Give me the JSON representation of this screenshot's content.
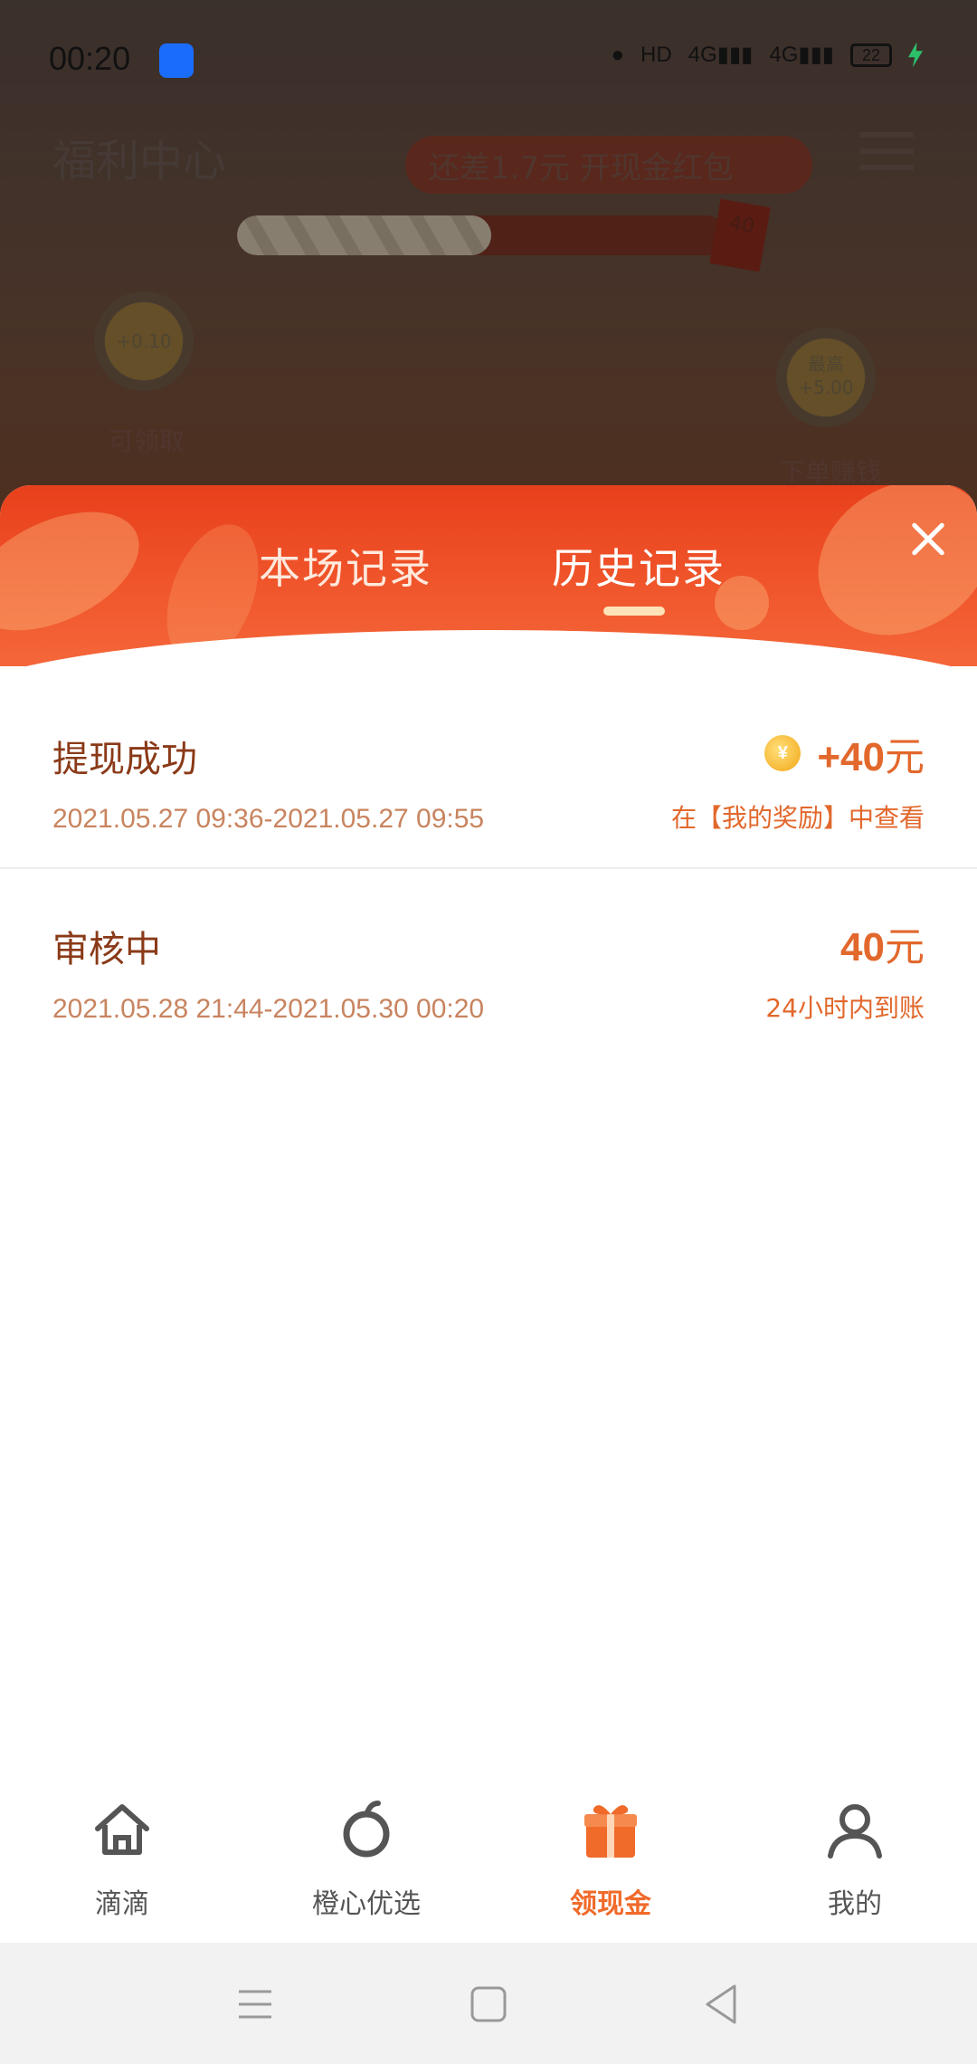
{
  "status_bar": {
    "time": "00:20",
    "battery": "22"
  },
  "background": {
    "title": "福利中心",
    "pill_text": "还差1.7元 开现金红包",
    "progress_box": "40",
    "progress_fraction": 0.52,
    "left_coin_value": "+0.10",
    "left_coin_label": "可领取",
    "right_coin_value_top": "最高",
    "right_coin_value_bottom": "+5.00",
    "right_coin_label": "下单赚钱"
  },
  "sheet": {
    "tabs": [
      {
        "label": "本场记录",
        "active": false
      },
      {
        "label": "历史记录",
        "active": true
      }
    ],
    "records": [
      {
        "status": "提现成功",
        "time_range": "2021.05.27 09:36-2021.05.27 09:55",
        "amount_num": "+40",
        "amount_unit": "元",
        "note": "在【我的奖励】中查看",
        "has_coin_icon": true
      },
      {
        "status": "审核中",
        "time_range": "2021.05.28 21:44-2021.05.30 00:20",
        "amount_num": "40",
        "amount_unit": "元",
        "note": "24小时内到账",
        "has_coin_icon": false
      }
    ]
  },
  "bottom_nav": [
    {
      "label": "滴滴",
      "icon": "home-icon"
    },
    {
      "label": "橙心优选",
      "icon": "orange-icon"
    },
    {
      "label": "领现金",
      "icon": "gift-icon",
      "active": true
    },
    {
      "label": "我的",
      "icon": "profile-icon"
    }
  ],
  "colors": {
    "accent": "#f06a2a",
    "sheet_header": "#e8401c",
    "record_text": "#8a3a18",
    "amount": "#e2682c"
  }
}
